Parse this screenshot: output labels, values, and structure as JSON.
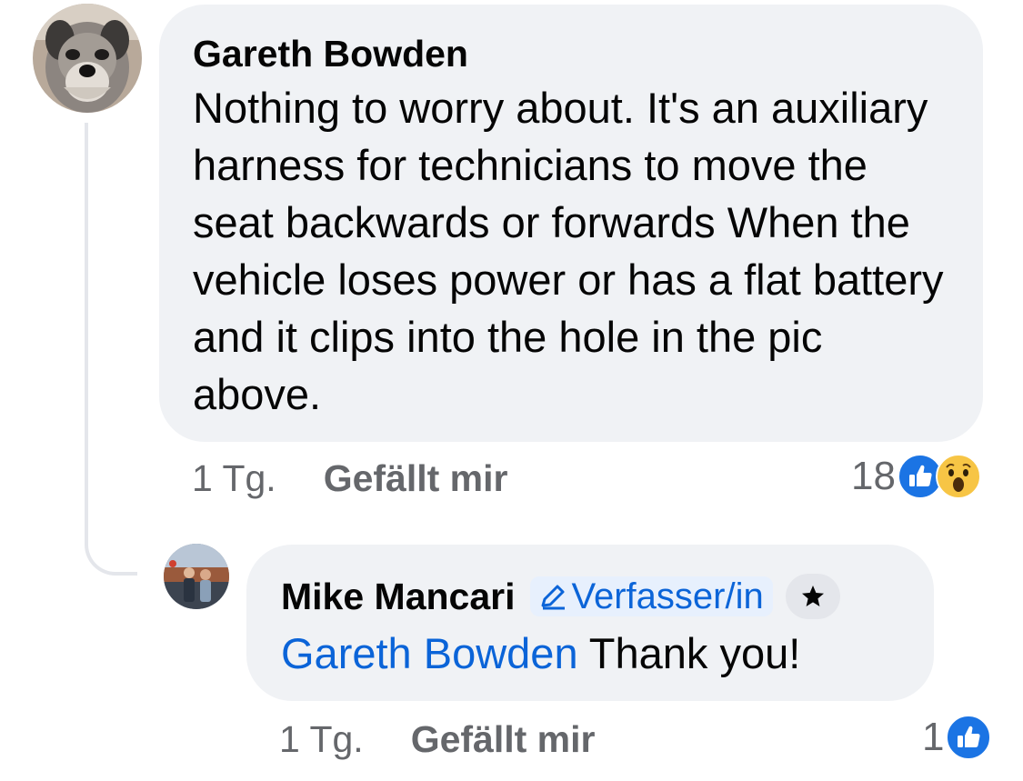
{
  "comment": {
    "author": "Gareth Bowden",
    "text": "Nothing to worry about. It's an auxiliary harness for technicians to move the seat backwards or forwards When the vehicle loses power or has a flat battery and it clips into the hole in the pic above.",
    "time": "1 Tg.",
    "like_label": "Gefällt mir",
    "reaction_count": "18",
    "reactions": [
      "like-icon",
      "wow-icon"
    ]
  },
  "reply": {
    "author": "Mike Mancari",
    "author_badge": "Verfasser/in",
    "mention": "Gareth Bowden",
    "text": " Thank you!",
    "time": "1 Tg.",
    "like_label": "Gefällt mir",
    "reaction_count": "1",
    "reactions": [
      "like-icon"
    ]
  },
  "colors": {
    "bubble": "#f0f2f5",
    "accent_blue": "#0b64d8",
    "meta_gray": "#65676b",
    "thread_line": "#e4e6eb"
  }
}
